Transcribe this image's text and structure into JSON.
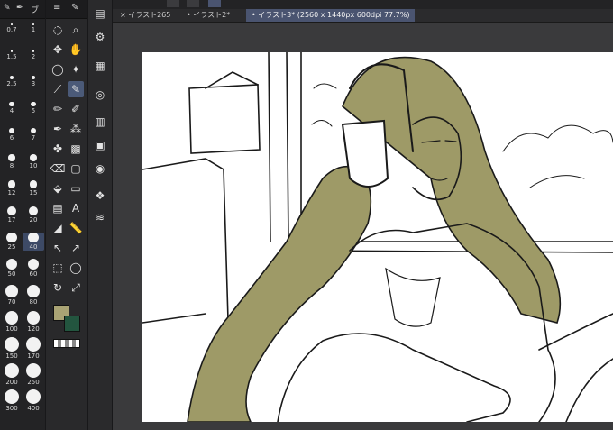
{
  "brush_panel": {
    "header_labels": [
      "ブ"
    ],
    "sizes": [
      "0.7",
      "1",
      "1.5",
      "2",
      "2.5",
      "3",
      "4",
      "5",
      "6",
      "7",
      "8",
      "10",
      "12",
      "15",
      "17",
      "20",
      "25",
      "40",
      "50",
      "60",
      "70",
      "80",
      "100",
      "120",
      "150",
      "170",
      "200",
      "250",
      "300",
      "400"
    ],
    "selected_size": "40"
  },
  "tools": {
    "icons": [
      "lasso-select-icon",
      "zoom-icon",
      "move-icon",
      "hand-icon",
      "lasso-icon",
      "magic-wand-icon",
      "eyedropper-icon",
      "pen-icon",
      "pencil-icon",
      "marker-icon",
      "brush-icon",
      "airbrush-icon",
      "blend-icon",
      "pattern-icon",
      "eraser-icon",
      "fill-icon",
      "bucket-icon",
      "shape-rect-icon",
      "gradient-icon",
      "text-icon",
      "figure-icon",
      "ruler-icon",
      "operation-icon",
      "correct-line-icon",
      "frame-icon",
      "balloon-icon",
      "rotate-icon",
      "transform-icon"
    ],
    "selected": "pen-icon"
  },
  "colors": {
    "main": "#a9a374",
    "sub": "#23553f",
    "accent_tab": "#4a5470",
    "hair": "#9e9a67"
  },
  "tabs": [
    {
      "label": "イラスト265",
      "active": false
    },
    {
      "label": "イラスト2*",
      "active": false
    },
    {
      "label": "イラスト3* (2560 x 1440px 600dpi 77.7%)",
      "active": true
    }
  ]
}
